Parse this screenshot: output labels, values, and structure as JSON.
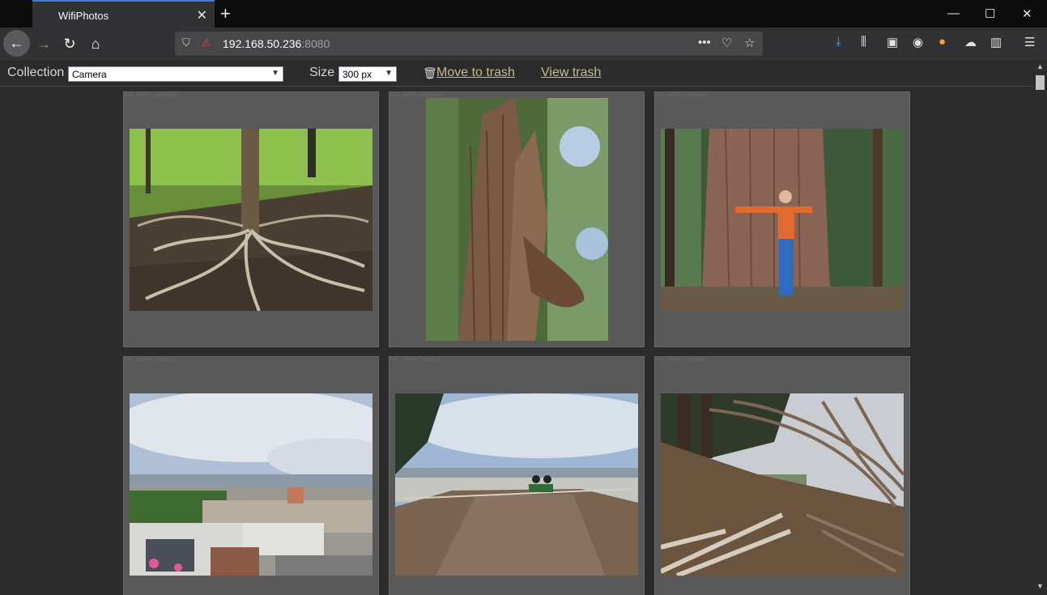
{
  "browser": {
    "tab_title": "WifiPhotos",
    "url_host": "192.168.50.236",
    "url_port": ":8080"
  },
  "toolbar": {
    "collection_label": "Collection",
    "collection_value": "Camera",
    "size_label": "Size",
    "size_value": "300 px",
    "move_to_trash": "Move to trash",
    "view_trash": "View trash"
  },
  "photos": [
    {
      "filename": "IMG_20190714_103645.jpg",
      "subject": "roots-on-hillside"
    },
    {
      "filename": "IMG_20190714_103929.jpg",
      "subject": "redwood-trunk"
    },
    {
      "filename": "IMG_20190714_104238.jpg",
      "subject": "person-hugging-redwood"
    },
    {
      "filename": "IMG_20190714_115516.jpg",
      "subject": "city-view"
    },
    {
      "filename": "IMG_20190714_115604.jpg",
      "subject": "hilltop-bench"
    },
    {
      "filename": "IMG_20190714_120113.jpg",
      "subject": "cypress-trail"
    }
  ],
  "colors": {
    "accent": "#3b7fd8",
    "link": "#c8b98a",
    "card": "#595959"
  }
}
